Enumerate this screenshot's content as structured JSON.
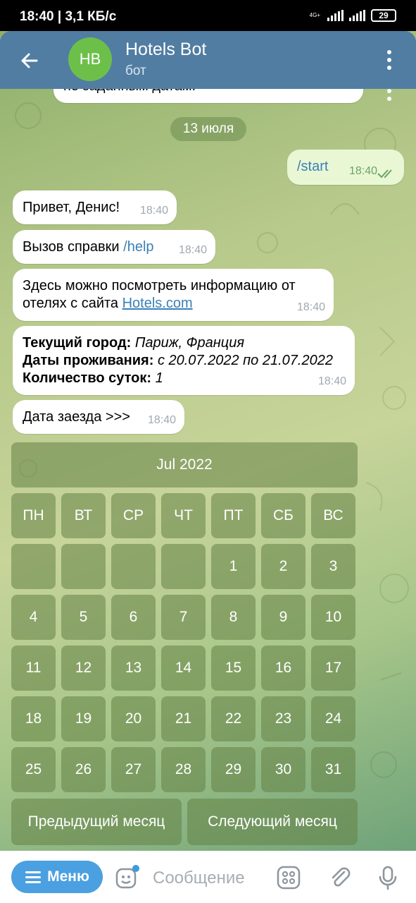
{
  "status": {
    "time": "18:40 | 3,1 КБ/с",
    "net_label": "4G+",
    "battery": "29"
  },
  "header": {
    "avatar_initials": "HB",
    "title": "Hotels Bot",
    "subtitle": "бот"
  },
  "messages": {
    "partial_text": "по заданным датам.",
    "date_chip": "13 июля",
    "out_start": {
      "text": "/start",
      "time": "18:40"
    },
    "greet": {
      "text": "Привет, Денис!",
      "time": "18:40"
    },
    "help": {
      "prefix": "Вызов справки ",
      "cmd": "/help",
      "time": "18:40"
    },
    "info": {
      "line1": "Здесь можно посмотреть информацию от",
      "line2_prefix": "отелях с сайта ",
      "link": "Hotels.com",
      "time": "18:40"
    },
    "summary": {
      "city_label": "Текущий город:",
      "city_value": " Париж, Франция",
      "dates_label": "Даты проживания:",
      "dates_value": " с 20.07.2022 по 21.07.2022",
      "nights_label": "Количество суток:",
      "nights_value": " 1",
      "time": "18:40"
    },
    "checkin": {
      "text": "Дата заезда >>>",
      "time": "18:40"
    }
  },
  "keyboard": {
    "month": "Jul 2022",
    "weekdays": [
      "ПН",
      "ВТ",
      "СР",
      "ЧТ",
      "ПТ",
      "СБ",
      "ВС"
    ],
    "weeks": [
      [
        "",
        "",
        "",
        "",
        "1",
        "2",
        "3"
      ],
      [
        "4",
        "5",
        "6",
        "7",
        "8",
        "9",
        "10"
      ],
      [
        "11",
        "12",
        "13",
        "14",
        "15",
        "16",
        "17"
      ],
      [
        "18",
        "19",
        "20",
        "21",
        "22",
        "23",
        "24"
      ],
      [
        "25",
        "26",
        "27",
        "28",
        "29",
        "30",
        "31"
      ]
    ],
    "prev": "Предыдущий месяц",
    "next": "Следующий месяц"
  },
  "input": {
    "menu_label": "Меню",
    "placeholder": "Сообщение"
  },
  "colors": {
    "header": "#517da2",
    "accent": "#4aa0e0",
    "avatar": "#6cc04a"
  }
}
